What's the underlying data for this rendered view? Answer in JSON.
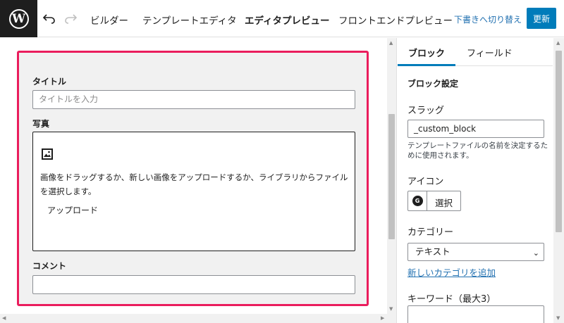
{
  "topbar": {
    "logo": "W",
    "tabs": [
      {
        "label": "ビルダー"
      },
      {
        "label": "テンプレートエディタ"
      },
      {
        "label": "エディタプレビュー"
      },
      {
        "label": "フロントエンドプレビュー"
      }
    ],
    "switch_draft": "下書きへ切り替え",
    "update": "更新"
  },
  "block": {
    "title_label": "タイトル",
    "title_placeholder": "タイトルを入力",
    "photo_label": "写真",
    "photo_desc": "画像をドラッグするか、新しい画像をアップロードするか、ライブラリからファイルを選択します。",
    "upload_label": "アップロード",
    "comment_label": "コメント"
  },
  "sidebar": {
    "tabs": [
      {
        "label": "ブロック"
      },
      {
        "label": "フィールド"
      }
    ],
    "heading": "ブロック設定",
    "slug_label": "スラッグ",
    "slug_value": "_custom_block",
    "slug_help": "テンプレートファイルの名前を決定するために使用されます。",
    "icon_label": "アイコン",
    "icon_preview": "G",
    "icon_select": "選択",
    "category_label": "カテゴリー",
    "category_value": "テキスト",
    "add_category": "新しいカテゴリを追加",
    "keywords_label": "キーワード（最大3）"
  },
  "colors": {
    "accent": "#007cba",
    "block_border": "#ea1d5d",
    "link": "#2271b1"
  }
}
